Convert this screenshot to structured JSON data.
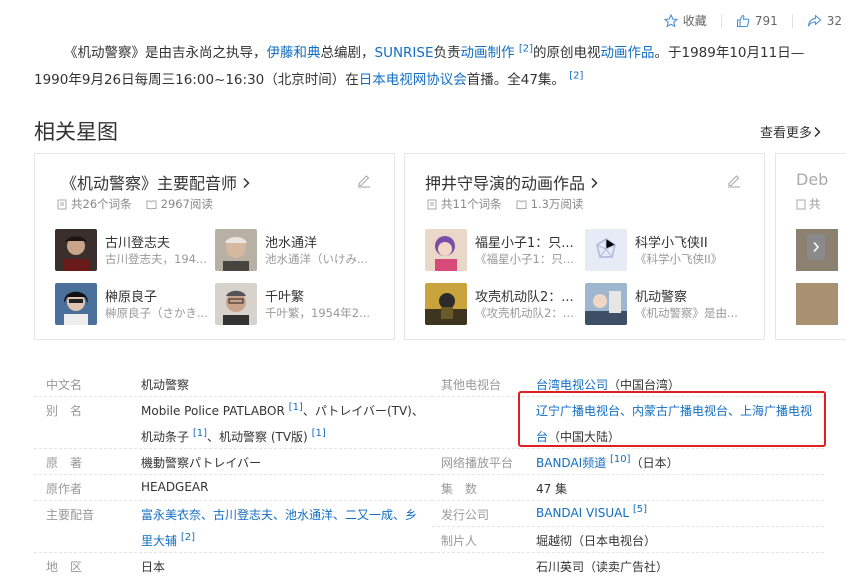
{
  "topbar": {
    "favorite_label": "收藏",
    "like_count": "791",
    "share_count": "32"
  },
  "intro": {
    "p1_a": "《机动警察》是由吉永尚之执导，",
    "p1_b": "伊藤和典",
    "p1_c": "总编剧，",
    "p1_d": "SUNRISE",
    "p1_e": "负责",
    "p1_f": "动画制作",
    "p1_g": "[2]",
    "p1_h": "的原创电视",
    "p1_i": "动画作品",
    "p1_j": "。于1989年10月11日—1990年9月26日每周三16:00~16:30（北京时间）在",
    "p1_k": "日本电视网协议会",
    "p1_l": "首播。全47集。",
    "p1_m": "[2]"
  },
  "section": {
    "title": "相关星图",
    "more_label": "查看更多"
  },
  "cards": [
    {
      "title": "《机动警察》主要配音师",
      "entries": "共26个词条",
      "views": "2967阅读",
      "people": [
        {
          "name": "古川登志夫",
          "sub": "古川登志夫，194..."
        },
        {
          "name": "池水通洋",
          "sub": "池水通洋（いけみ..."
        },
        {
          "name": "榊原良子",
          "sub": "榊原良子（さかき..."
        },
        {
          "name": "千叶繁",
          "sub": "千叶繁，1954年2..."
        }
      ]
    },
    {
      "title": "押井守导演的动画作品",
      "entries": "共11个词条",
      "views": "1.3万阅读",
      "people": [
        {
          "name": "福星小子1：只...",
          "sub": "《福星小子1：只..."
        },
        {
          "name": "科学小飞侠II",
          "sub": "《科学小飞侠II》"
        },
        {
          "name": "攻壳机动队2：...",
          "sub": "《攻壳机动队2：..."
        },
        {
          "name": "机动警察",
          "sub": "《机动警察》是由..."
        }
      ]
    }
  ],
  "card3": {
    "title": "Deb",
    "entries": "共"
  },
  "info": {
    "left": [
      {
        "label": "中文名",
        "value": "机动警察"
      },
      {
        "label": "别　名",
        "value_a": "Mobile Police PATLABOR",
        "sup_a": "[1]",
        "value_b": "、パトレイバー(TV)、",
        "value_c": "机动条子",
        "sup_c": "[1]",
        "value_d": "、机动警察 (TV版)",
        "sup_d": "[1]"
      },
      {
        "label": "原　著",
        "value": "機動警察パトレイバー"
      },
      {
        "label": "原作者",
        "value": "HEADGEAR"
      },
      {
        "label": "主要配音",
        "value_a": "富永美衣奈、古川登志夫、池水通洋、二又一成、乡",
        "value_b": "里大辅",
        "sup_b": "[2]"
      },
      {
        "label": "地　区",
        "value": "日本"
      }
    ],
    "right": [
      {
        "label": "其他电视台",
        "link": "台湾电视公司",
        "value": "（中国台湾）"
      },
      {
        "label": "",
        "link": "辽宁广播电视台、内蒙古广播电视台、上海广播电视",
        "link2": "台",
        "value": "（中国大陆）"
      },
      {
        "label": "网络播放平台",
        "link": "BANDAI频道",
        "sup": "[10]",
        "value": "（日本）"
      },
      {
        "label": "集　数",
        "value": "47 集"
      },
      {
        "label": "发行公司",
        "link": "BANDAI VISUAL",
        "sup": "[5]"
      },
      {
        "label": "制片人",
        "value": "堀越彻（日本电视台）"
      },
      {
        "label": "",
        "value": "石川英司（读卖广告社）"
      }
    ]
  },
  "colors": {
    "link": "#136ec2",
    "highlight_box": "#e02020"
  }
}
